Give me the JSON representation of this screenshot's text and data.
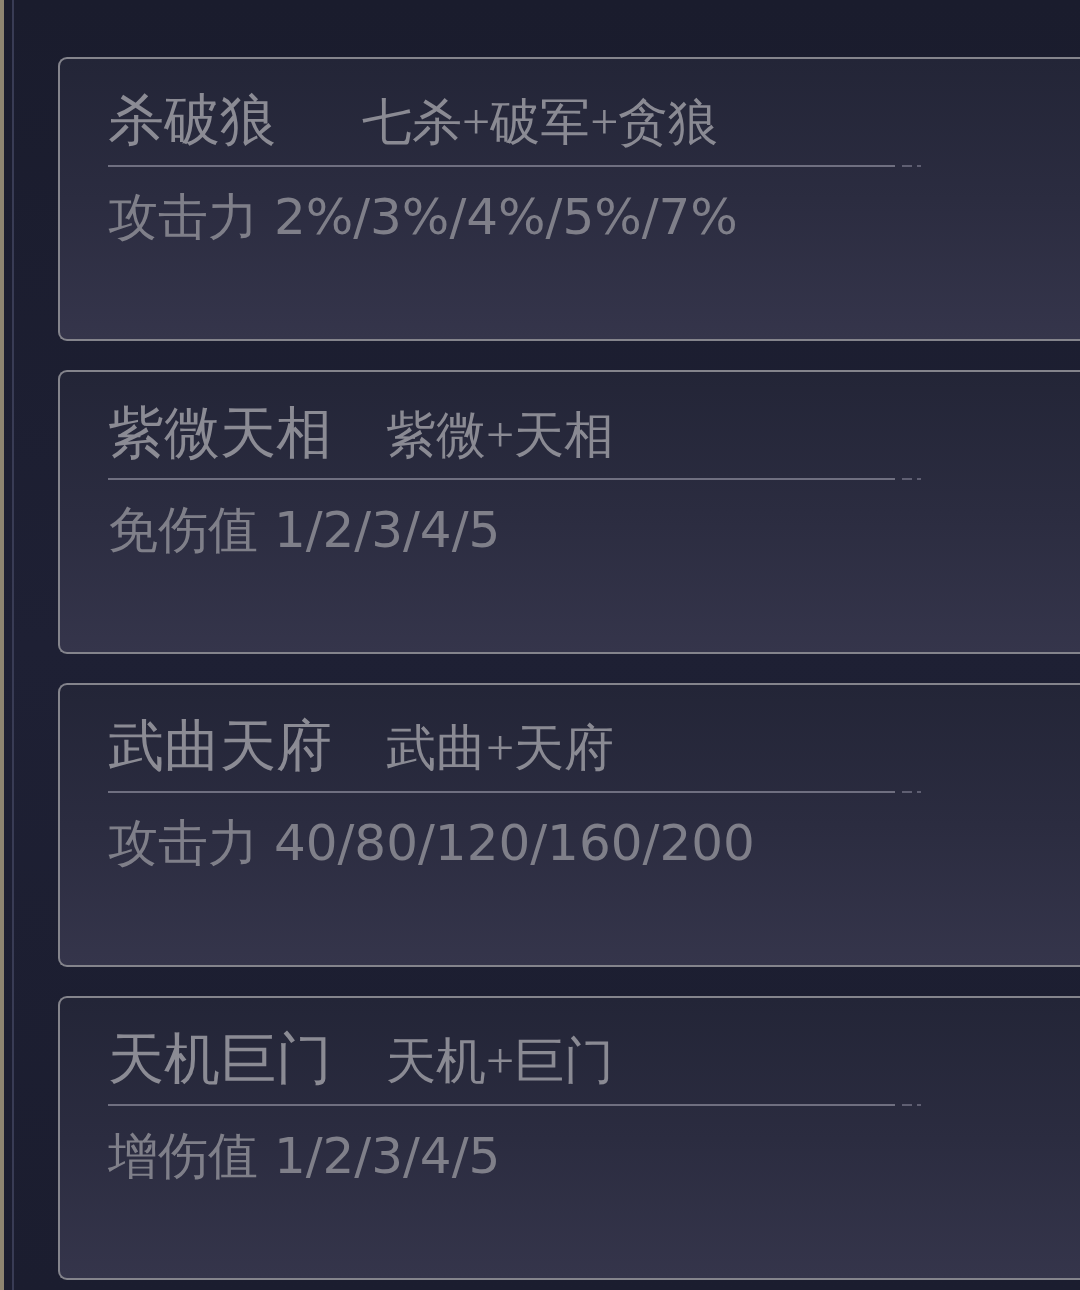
{
  "cards": [
    {
      "title": "杀破狼",
      "combo": "七杀+破军+贪狼",
      "effect": "攻击力 2%/3%/4%/5%/7%"
    },
    {
      "title": "紫微天相",
      "combo": "紫微+天相",
      "effect": "免伤值 1/2/3/4/5"
    },
    {
      "title": "武曲天府",
      "combo": "武曲+天府",
      "effect": "攻击力 40/80/120/160/200"
    },
    {
      "title": "天机巨门",
      "combo": "天机+巨门",
      "effect": "增伤值 1/2/3/4/5"
    }
  ]
}
